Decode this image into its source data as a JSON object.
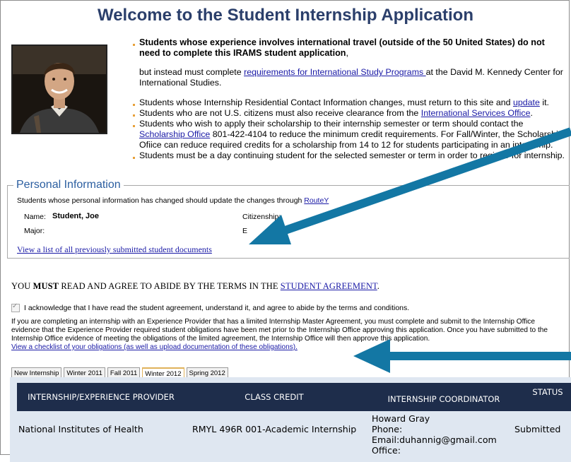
{
  "title": "Welcome to the Student Internship Application",
  "bullets": {
    "b1_strong": "Students whose experience involves international travel (outside of the 50 United States) do not need to complete this IRAMS student application",
    "b1_comma": ",",
    "b1_pre": "but instead must complete ",
    "b1_link": "requirements for International Study Programs ",
    "b1_post": "at the David M. Kennedy Center for International Studies.",
    "b2_pre": "Students whose Internship Residential Contact Information changes, must return to this site and ",
    "b2_link": "update",
    "b2_post": " it.",
    "b3_pre": "Students who are not U.S. citizens must also receive clearance from the ",
    "b3_link": "International Services Office",
    "b3_post": ".",
    "b4_pre": "Students who wish to apply their scholarship to their internship semester or term should contact the ",
    "b4_link": "Scholarship Office",
    "b4_post": " 801-422-4104 to reduce the minimum credit requirements. For Fall/Winter, the Scholarship Ofiice can reduce required credits for a scholarship from 14 to 12 for students participating in an internship.",
    "b5": "Students must be a day continuing student for the selected semester or term in order to register for internship."
  },
  "personal": {
    "legend": "Personal Information",
    "note_pre": "Students whose personal information has changed should update the changes through ",
    "note_link": "RouteY",
    "name_label": "Name:",
    "name_value": "Student, Joe",
    "major_label": "Major:",
    "citizenship_label": "Citizenship:",
    "e_label": "E",
    "doc_link": "View a list of all previously submitted student documents"
  },
  "agreement": {
    "pre": "YOU ",
    "must": "MUST",
    "mid": " READ AND AGREE TO ABIDE BY THE TERMS IN THE ",
    "link": "STUDENT AGREEMENT",
    "post": ".",
    "ack": "I acknowledge that I have read the student agreement, understand it, and agree to abide by the terms and conditions.",
    "paragraph": "If you are completing an internship with an Experience Provider that has a limited Internship Master Agreement, you must complete and submit to the Internship Office evidence that the Experience Provider required student obligations have been met prior to the Internship Office approving this application. Once you have submitted to the Internship Office evidence of meeting the obligations of the limited agreement, the Internship Office will then approve this application.",
    "checklist_link": "View a checklist of your obligations (as well as upload documentation of these obligations)."
  },
  "tabs": [
    {
      "label": "New Internship"
    },
    {
      "label": "Winter 2011"
    },
    {
      "label": "Fall 2011"
    },
    {
      "label": "Winter 2012"
    },
    {
      "label": "Spring 2012"
    }
  ],
  "active_tab": "Winter 2012",
  "table": {
    "headers": [
      "INTERNSHIP/EXPERIENCE PROVIDER",
      "CLASS CREDIT",
      "INTERNSHIP COORDINATOR",
      "STATUS"
    ],
    "row": {
      "provider": "National Institutes of Health",
      "credit": "RMYL 496R 001-Academic Internship",
      "coordinator": [
        "Howard Gray",
        "Phone:",
        "Email:duhannig@gmail.com",
        "Office:"
      ],
      "status": "Submitted"
    }
  },
  "colors": {
    "title": "#2b3f6b",
    "arrow": "#1377a4",
    "table_header": "#1e2d4b",
    "link": "#1a1aa6"
  }
}
